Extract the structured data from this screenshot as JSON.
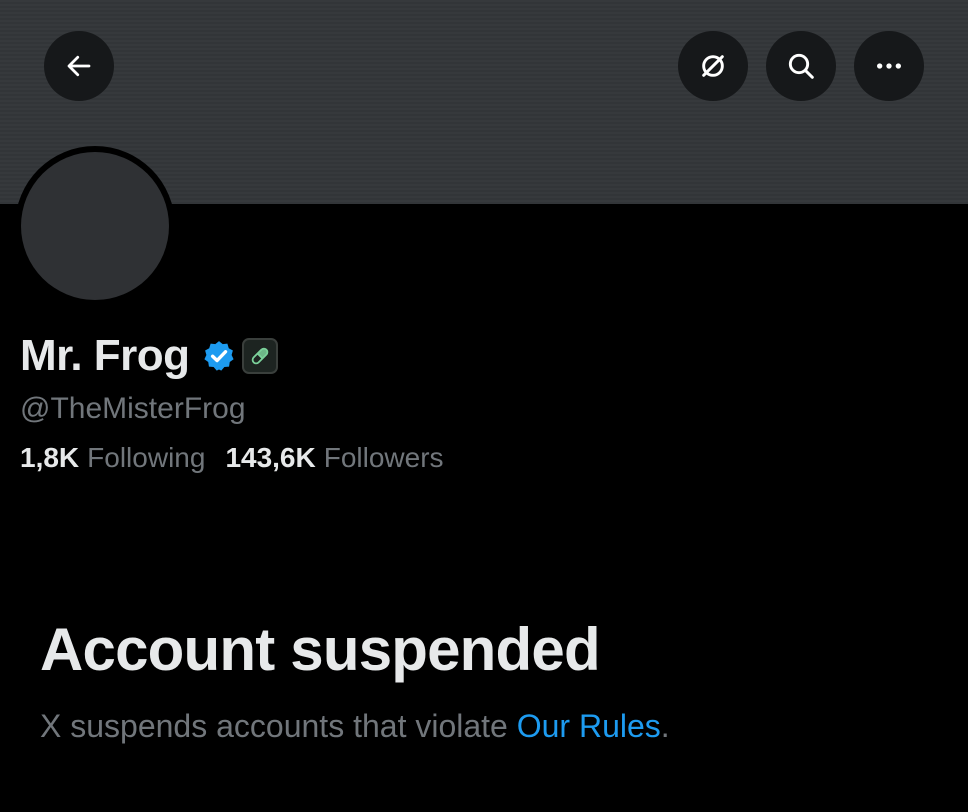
{
  "header": {
    "back_icon": "arrow-left-icon",
    "grok_icon": "grok-slash-circle-icon",
    "search_icon": "search-icon",
    "more_icon": "more-dots-icon"
  },
  "profile": {
    "display_name": "Mr. Frog",
    "handle": "@TheMisterFrog",
    "verified_color": "#1d9bf0",
    "pill_color": "#7bd19a"
  },
  "stats": {
    "following_count": "1,8K",
    "following_label": "Following",
    "followers_count": "143,6K",
    "followers_label": "Followers"
  },
  "suspension": {
    "title": "Account suspended",
    "message_prefix": "X suspends accounts that violate ",
    "link_text": "Our Rules",
    "message_suffix": ".",
    "link_color": "#1d9bf0"
  }
}
